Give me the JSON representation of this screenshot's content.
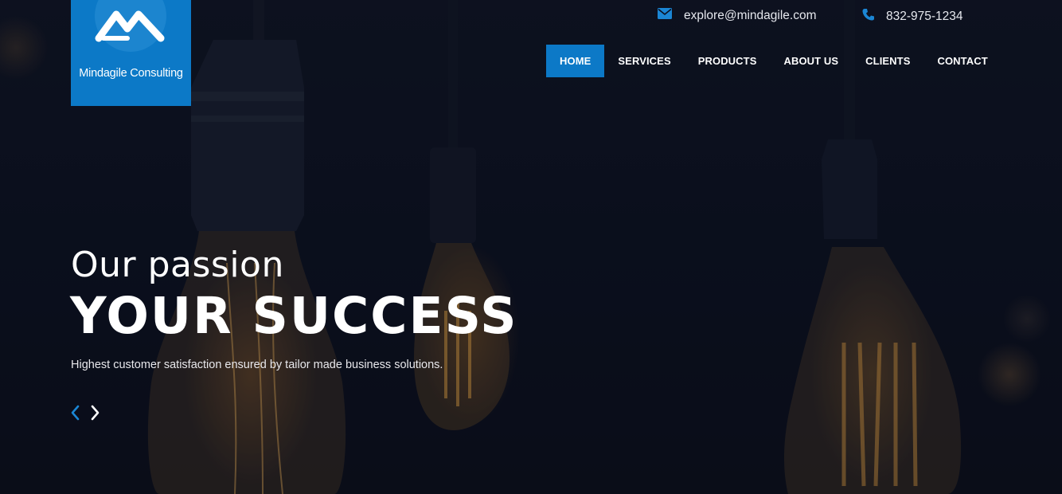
{
  "brand": {
    "name": "Mindagile Consulting",
    "logo_icon": "mountain-peaks-icon"
  },
  "contact": {
    "email": "explore@mindagile.com",
    "email_icon": "envelope-icon",
    "phone": "832-975-1234",
    "phone_icon": "phone-icon"
  },
  "nav": {
    "items": [
      {
        "label": "HOME",
        "active": true
      },
      {
        "label": "SERVICES"
      },
      {
        "label": "PRODUCTS"
      },
      {
        "label": "ABOUT US"
      },
      {
        "label": "CLIENTS"
      },
      {
        "label": "CONTACT"
      }
    ]
  },
  "hero": {
    "kicker": "Our passion",
    "headline": "YOUR SUCCESS",
    "subtitle": "Highest customer satisfaction ensured by tailor made business solutions.",
    "prev_icon": "chevron-left-icon",
    "next_icon": "chevron-right-icon"
  },
  "colors": {
    "accent": "#0c79c7",
    "background": "#0b0f1c"
  }
}
